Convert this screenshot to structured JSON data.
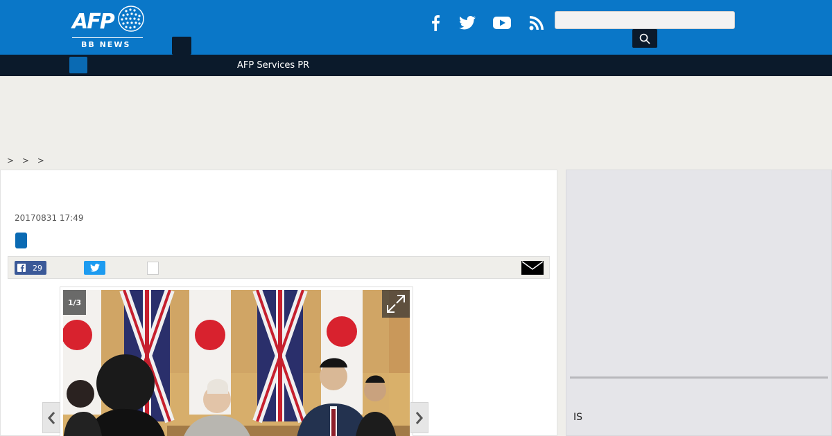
{
  "header": {
    "logo_text": "AFP",
    "logo_sub": "BB NEWS",
    "search": {
      "value": "",
      "placeholder": ""
    },
    "social": [
      "facebook-icon",
      "twitter-icon",
      "youtube-icon",
      "rss-icon"
    ],
    "brand_color": "#0a77c8",
    "dark_color": "#0b1a2b"
  },
  "nav": {
    "items": [
      {
        "label": "AFP Services PR"
      }
    ]
  },
  "breadcrumb": {
    "text": "> > >"
  },
  "article": {
    "timestamp": "20170831 17:49",
    "share": {
      "facebook_count": "29"
    },
    "gallery": {
      "counter": "1/3"
    }
  },
  "sidebar": {
    "label": "IS"
  }
}
